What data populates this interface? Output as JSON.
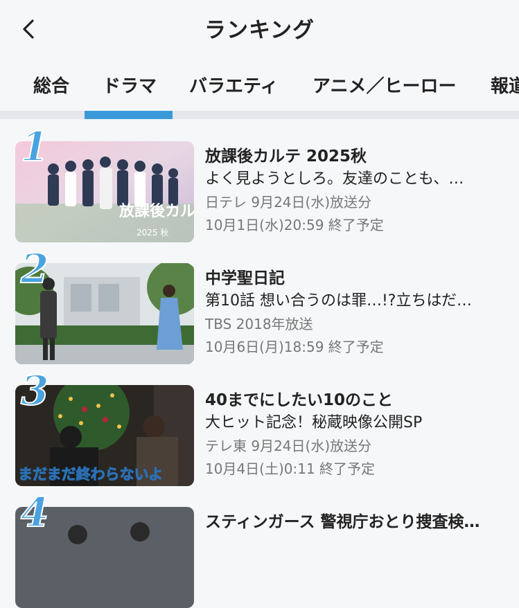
{
  "header": {
    "title": "ランキング"
  },
  "tabs": [
    {
      "label": "総合"
    },
    {
      "label": "ドラマ"
    },
    {
      "label": "バラエティ"
    },
    {
      "label": "アニメ／ヒーロー"
    },
    {
      "label": "報道"
    }
  ],
  "active_tab": "ドラマ",
  "items": [
    {
      "rank": "1",
      "title": "放課後カルテ 2025秋",
      "episode": "よく見ようとしろ。友達のことも、…",
      "broadcast": "日テレ 9月24日(水)放送分",
      "expires": "10月1日(水)20:59 終了予定",
      "thumb_text": "放課後カルテ",
      "thumb_sub": "2025 秋"
    },
    {
      "rank": "2",
      "title": "中学聖日記",
      "episode": "第10話 想い合うのは罪…!?立ちはだ…",
      "broadcast": "TBS 2018年放送",
      "expires": "10月6日(月)18:59 終了予定"
    },
    {
      "rank": "3",
      "title": "40までにしたい10のこと",
      "episode": "大ヒット記念！秘蔵映像公開SP",
      "broadcast": "テレ東 9月24日(水)放送分",
      "expires": "10月4日(土)0:11 終了予定",
      "thumb_text": "まだまだ終わらないよ"
    },
    {
      "rank": "4",
      "title": "スティンガース 警視庁おとり捜査検…"
    }
  ]
}
